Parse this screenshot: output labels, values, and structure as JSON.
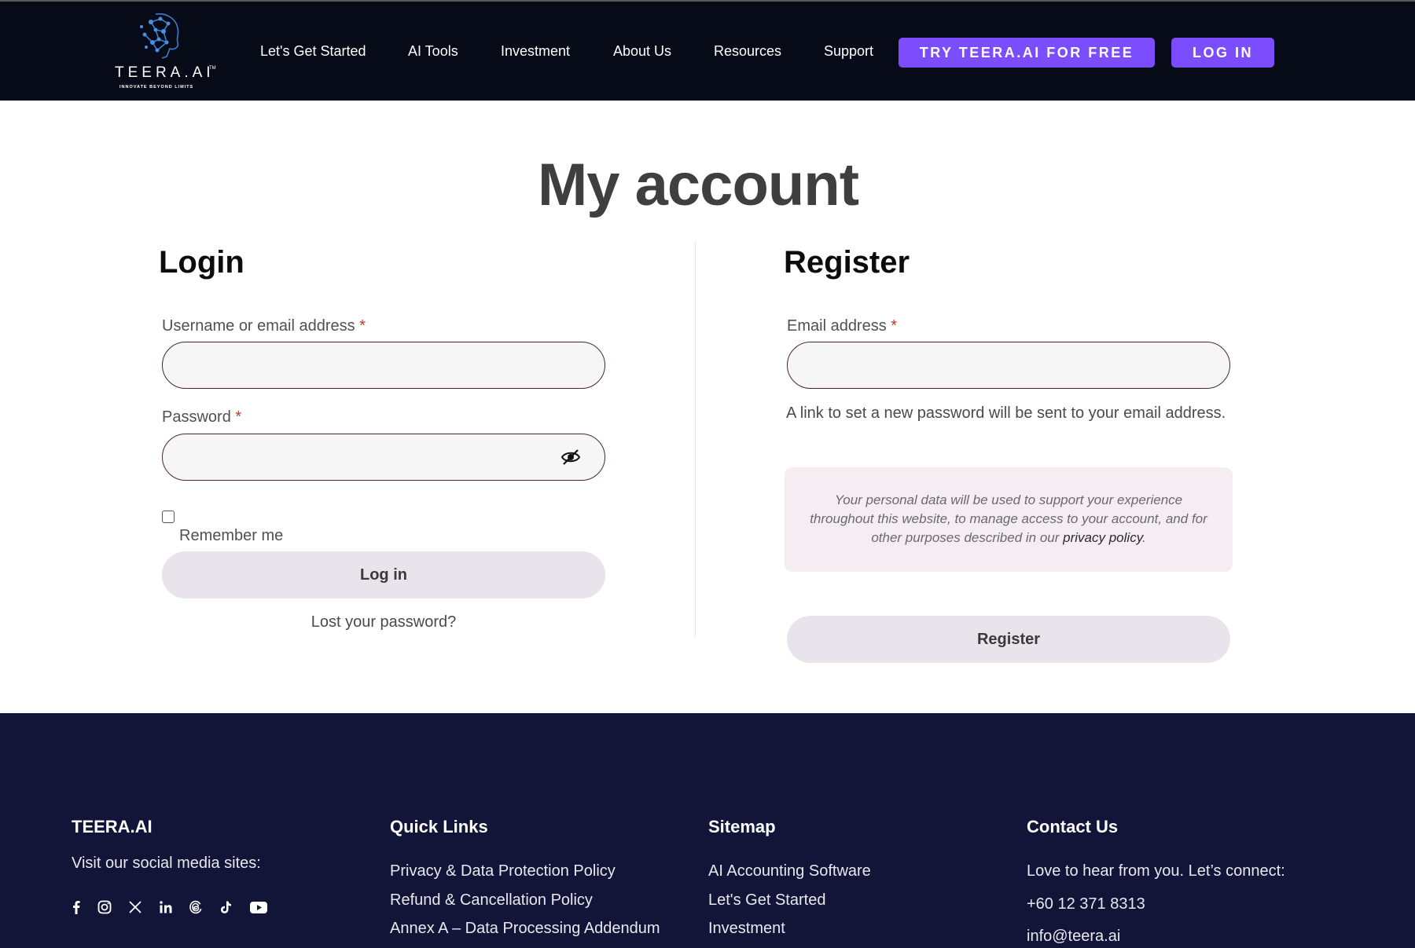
{
  "header": {
    "logo_text": "TEERA.AI",
    "logo_tm": "TM",
    "logo_tagline": "INNOVATE BEYOND LIMITS",
    "nav": [
      "Let's Get Started",
      "AI Tools",
      "Investment",
      "About Us",
      "Resources",
      "Support"
    ],
    "cta_try": "TRY TEERA.AI FOR FREE",
    "cta_login": "LOG IN"
  },
  "main": {
    "title": "My account",
    "login": {
      "title": "Login",
      "username_label": "Username or email address",
      "password_label": "Password",
      "required_mark": "*",
      "remember_label": "Remember me",
      "submit_label": "Log in",
      "lost_password": "Lost your password?"
    },
    "register": {
      "title": "Register",
      "email_label": "Email address",
      "required_mark": "*",
      "hint": "A link to set a new password will be sent to your email address.",
      "privacy_text": "Your personal data will be used to support your experience throughout this website, to manage access to your account, and for other purposes described in our",
      "privacy_link": "privacy policy",
      "privacy_end": ".",
      "submit_label": "Register"
    }
  },
  "footer": {
    "brand": {
      "title": "TEERA.AI",
      "social_text": "Visit our social media sites:",
      "socials": [
        "facebook-icon",
        "instagram-icon",
        "x-icon",
        "linkedin-icon",
        "threads-icon",
        "tiktok-icon",
        "youtube-icon"
      ]
    },
    "quick_links": {
      "title": "Quick Links",
      "items": [
        "Privacy & Data Protection Policy",
        "Refund & Cancellation Policy",
        "Annex A – Data Processing Addendum"
      ]
    },
    "sitemap": {
      "title": "Sitemap",
      "items": [
        "AI Accounting Software",
        "Let's Get Started",
        "Investment"
      ]
    },
    "contact": {
      "title": "Contact Us",
      "intro": "Love to hear from you. Let’s connect:",
      "phone": "+60 12 371 8313",
      "email": "info@teera.ai"
    }
  },
  "colors": {
    "header_bg": "#070a17",
    "accent_purple": "#7c4dff",
    "footer_bg": "#121537",
    "soft_button": "#e9e3ec",
    "privacy_bg": "#f5edf1"
  }
}
